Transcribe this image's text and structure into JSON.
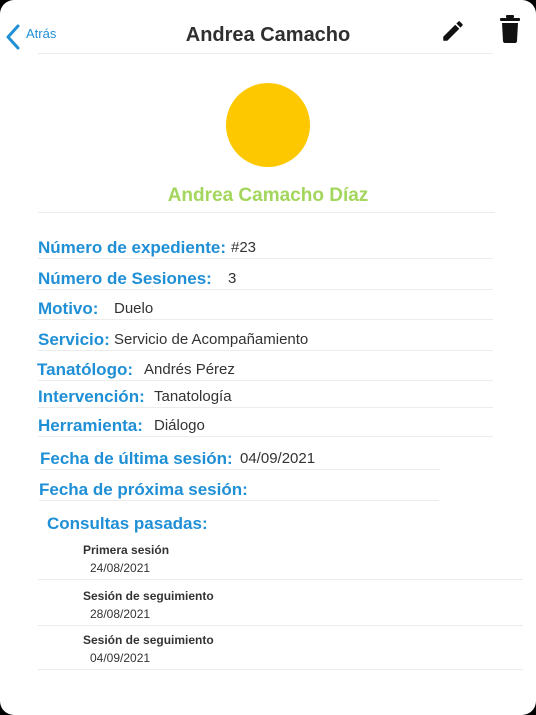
{
  "header": {
    "back_label": "Atrás",
    "title": "Andrea Camacho",
    "edit_icon": "pencil-icon",
    "delete_icon": "trash-icon"
  },
  "profile": {
    "full_name": "Andrea Camacho Díaz",
    "avatar_color": "#fdc800"
  },
  "fields": {
    "expediente": {
      "label": "Número de expediente:",
      "value": "#23"
    },
    "sesiones": {
      "label": "Número de Sesiones:",
      "value": "3"
    },
    "motivo": {
      "label": "Motivo:",
      "value": "Duelo"
    },
    "servicio": {
      "label": "Servicio:",
      "value": "Servicio de Acompañamiento"
    },
    "tanatologo": {
      "label": "Tanatólogo:",
      "value": "Andrés Pérez"
    },
    "intervencion": {
      "label": "Intervención:",
      "value": "Tanatología"
    },
    "herramienta": {
      "label": "Herramienta:",
      "value": "Diálogo"
    },
    "ultima_sesion": {
      "label": "Fecha de última sesión:",
      "value": "04/09/2021"
    },
    "proxima_sesion": {
      "label": "Fecha de próxima sesión:",
      "value": ""
    }
  },
  "consultas": {
    "title": "Consultas pasadas:",
    "items": [
      {
        "name": "Primera sesión",
        "date": "24/08/2021"
      },
      {
        "name": "Sesión de seguimiento",
        "date": "28/08/2021"
      },
      {
        "name": "Sesión de seguimiento",
        "date": "04/09/2021"
      }
    ]
  },
  "colors": {
    "accent_blue": "#1f8fd6",
    "name_green": "#a3d65c",
    "avatar_yellow": "#fdc800"
  }
}
